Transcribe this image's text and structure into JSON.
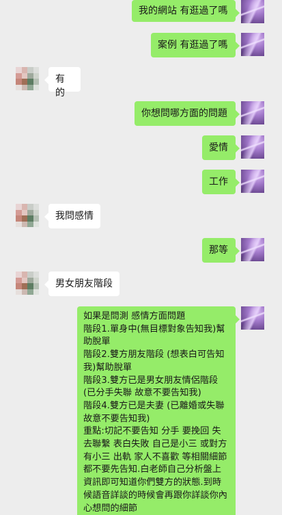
{
  "conversation": {
    "messages": [
      {
        "sender": "me",
        "text": "我的網站 有逛過了嗎"
      },
      {
        "sender": "me",
        "text": "案例 有逛過了嗎"
      },
      {
        "sender": "them",
        "text": "有的"
      },
      {
        "sender": "me",
        "text": "你想問哪方面的問題"
      },
      {
        "sender": "me",
        "text": "愛情"
      },
      {
        "sender": "me",
        "text": "工作"
      },
      {
        "sender": "them",
        "text": "我問感情"
      },
      {
        "sender": "me",
        "text": "那等"
      },
      {
        "sender": "them",
        "text": "男女朋友階段"
      },
      {
        "sender": "me",
        "lines": [
          "如果是問測 感情方面問題",
          "階段1.單身中(無目標對象告知我)幫助脫單",
          "階段2.雙方朋友階段 (想表白可告知我)幫助脫單",
          "階段3.雙方已是男女朋友情侶階段(已分手失聯 故意不要告知我)",
          "階段4.雙方已是夫妻 (已離婚或失聯 故意不要告知我)",
          "重點:切記不要告知 分手 要挽回 失去聯繫 表白失敗 自己是小三 或對方有小三 出軌 家人不喜歡 等相關細節都不要先告知.白老師自己分析盤上資訊即可知道你們雙方的狀態.到時候語音詳談的時候會再跟你詳談你內心想問的細節"
        ]
      }
    ]
  }
}
